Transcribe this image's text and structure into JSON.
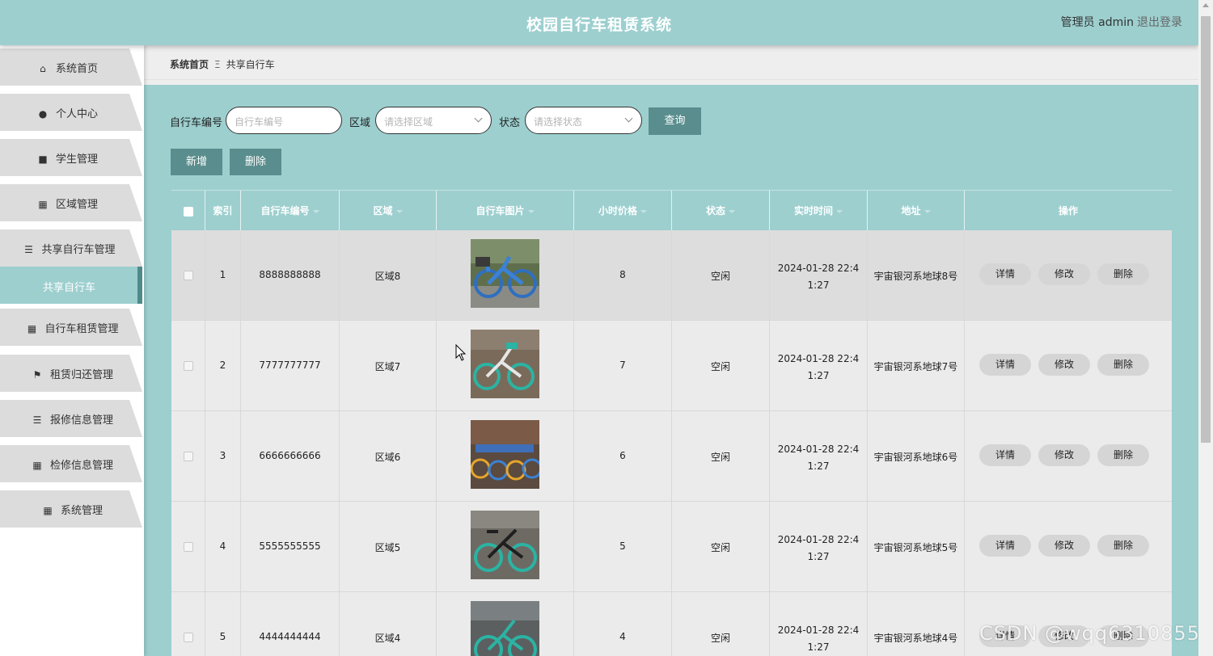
{
  "header": {
    "title": "校园自行车租赁系统",
    "user": "管理员 admin",
    "logout": "退出登录"
  },
  "sidebar": {
    "items": [
      {
        "label": "系统首页",
        "icon": "home-icon",
        "glyph": "⌂"
      },
      {
        "label": "个人中心",
        "icon": "person-icon",
        "glyph": "●"
      },
      {
        "label": "学生管理",
        "icon": "briefcase-icon",
        "glyph": "■"
      },
      {
        "label": "区域管理",
        "icon": "grid-icon",
        "glyph": "▦"
      },
      {
        "label": "共享自行车管理",
        "icon": "sliders-icon",
        "glyph": "☰"
      },
      {
        "label": "自行车租赁管理",
        "icon": "grid-icon",
        "glyph": "▦"
      },
      {
        "label": "租赁归还管理",
        "icon": "flag-icon",
        "glyph": "⚑"
      },
      {
        "label": "报修信息管理",
        "icon": "list-icon",
        "glyph": "☰"
      },
      {
        "label": "检修信息管理",
        "icon": "grid-icon",
        "glyph": "▦"
      },
      {
        "label": "系统管理",
        "icon": "grid-icon",
        "glyph": "▦"
      }
    ],
    "active_sub": "共享自行车"
  },
  "breadcrumb": {
    "home": "系统首页",
    "separator": "Ξ",
    "current": "共享自行车"
  },
  "search": {
    "bike_no_label": "自行车编号",
    "bike_no_placeholder": "自行车编号",
    "area_label": "区域",
    "area_placeholder": "请选择区域",
    "status_label": "状态",
    "status_placeholder": "请选择状态",
    "query_button": "查询"
  },
  "actions": {
    "add": "新增",
    "delete": "删除"
  },
  "table": {
    "columns": [
      "索引",
      "自行车编号",
      "区域",
      "自行车图片",
      "小时价格",
      "状态",
      "实时时间",
      "地址",
      "操作"
    ],
    "ops": {
      "detail": "详情",
      "edit": "修改",
      "delete": "删除"
    },
    "rows": [
      {
        "index": "1",
        "bike_no": "8888888888",
        "area": "区域8",
        "price": "8",
        "status": "空闲",
        "time_line1": "2024-01-28 22:4",
        "time_line2": "1:27",
        "address": "宇宙银河系地球8号"
      },
      {
        "index": "2",
        "bike_no": "7777777777",
        "area": "区域7",
        "price": "7",
        "status": "空闲",
        "time_line1": "2024-01-28 22:4",
        "time_line2": "1:27",
        "address": "宇宙银河系地球7号"
      },
      {
        "index": "3",
        "bike_no": "6666666666",
        "area": "区域6",
        "price": "6",
        "status": "空闲",
        "time_line1": "2024-01-28 22:4",
        "time_line2": "1:27",
        "address": "宇宙银河系地球6号"
      },
      {
        "index": "4",
        "bike_no": "5555555555",
        "area": "区域5",
        "price": "5",
        "status": "空闲",
        "time_line1": "2024-01-28 22:4",
        "time_line2": "1:27",
        "address": "宇宙银河系地球5号"
      },
      {
        "index": "5",
        "bike_no": "4444444444",
        "area": "区域4",
        "price": "4",
        "status": "空闲",
        "time_line1": "2024-01-28 22:4",
        "time_line2": "1:27",
        "address": "宇宙银河系地球4号"
      }
    ]
  },
  "watermark": "CSDN @wqq6310855",
  "colors": {
    "accent": "#9dcfcf",
    "button": "#5a8e8e",
    "row": "#ebebeb"
  }
}
